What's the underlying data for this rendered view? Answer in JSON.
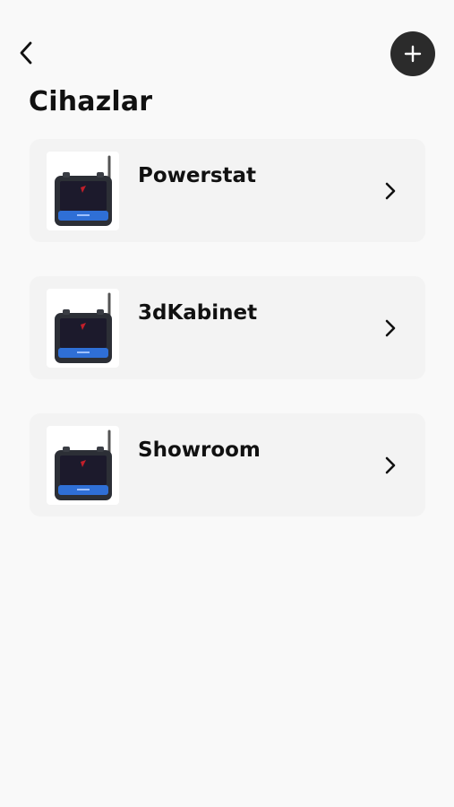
{
  "header": {
    "back_icon": "chevron-left-icon",
    "add_icon": "plus-icon",
    "title": "Cihazlar"
  },
  "devices": [
    {
      "name": "Powerstat",
      "image_icon": "thermostat-device-image",
      "chevron_icon": "chevron-right-icon"
    },
    {
      "name": "3dKabinet",
      "image_icon": "thermostat-device-image",
      "chevron_icon": "chevron-right-icon"
    },
    {
      "name": "Showroom",
      "image_icon": "thermostat-device-image",
      "chevron_icon": "chevron-right-icon"
    }
  ],
  "colors": {
    "background": "#f9f9f9",
    "card": "#f3f3f3",
    "add_button": "#2b2b2b",
    "text": "#111111",
    "device_accent": "#2f6fd6"
  }
}
